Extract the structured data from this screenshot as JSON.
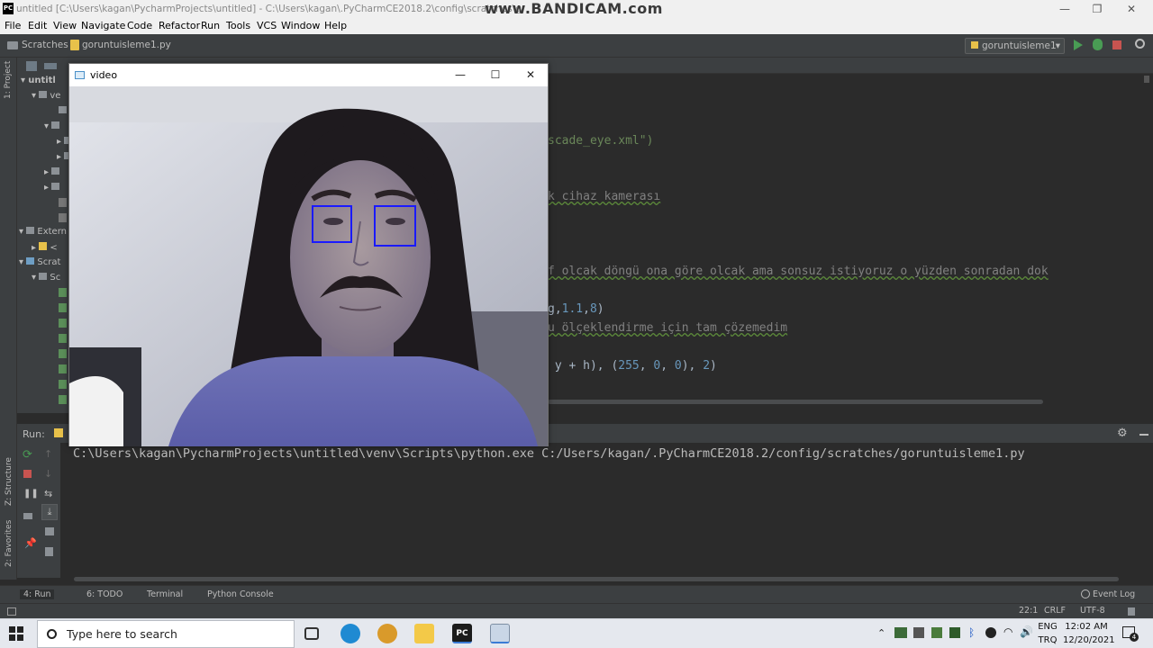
{
  "window": {
    "title": "untitled [C:\\Users\\kagan\\PycharmProjects\\untitled] - C:\\Users\\kagan\\.PyCharmCE2018.2\\config\\scratches\\goruntuisleme1.py",
    "watermark": "www.BANDICAM.com"
  },
  "menu": [
    "File",
    "Edit",
    "View",
    "Navigate",
    "Code",
    "Refactor",
    "Run",
    "Tools",
    "VCS",
    "Window",
    "Help"
  ],
  "breadcrumb": {
    "folder": "Scratches",
    "file": "goruntuisleme1.py"
  },
  "run_config": "goruntuisleme1",
  "tree": {
    "side_label": "1: Project",
    "rows": [
      "untitl",
      "ve",
      "",
      "",
      "",
      "",
      "",
      "",
      "",
      "Extern",
      "<",
      "Scrat",
      "Sc"
    ]
  },
  "editor": {
    "lines": [
      {
        "parts": [
          {
            "t": "scade_eye.xml\")",
            "c": "str"
          }
        ]
      },
      {
        "parts": [
          {
            "t": "k cihaz kamerası",
            "c": "cmt-u"
          }
        ]
      },
      {
        "parts": [
          {
            "t": "f olcak döngü ona göre olcak ama sonsuz istiyoruz o yüzden sonradan dok",
            "c": "cmt-u"
          }
        ]
      },
      {
        "parts": [
          {
            "t": "g,",
            "c": "plain"
          },
          {
            "t": "1.1",
            "c": "num"
          },
          {
            "t": ",",
            "c": "plain"
          },
          {
            "t": "8",
            "c": "num"
          },
          {
            "t": ")",
            "c": "plain"
          }
        ]
      },
      {
        "parts": [
          {
            "t": "u ölçeklendirme için tam çözemedim",
            "c": "cmt-u"
          }
        ]
      },
      {
        "parts": [
          {
            "t": " y + h), (",
            "c": "plain"
          },
          {
            "t": "255",
            "c": "num"
          },
          {
            "t": ", ",
            "c": "plain"
          },
          {
            "t": "0",
            "c": "num"
          },
          {
            "t": ", ",
            "c": "plain"
          },
          {
            "t": "0",
            "c": "num"
          },
          {
            "t": "), ",
            "c": "plain"
          },
          {
            "t": "2",
            "c": "num"
          },
          {
            "t": ")",
            "c": "plain"
          }
        ]
      }
    ]
  },
  "video_window": {
    "title": "video",
    "minimize": "—",
    "maximize": "☐",
    "close": "✕"
  },
  "run_panel": {
    "label": "Run:",
    "command": "C:\\Users\\kagan\\PycharmProjects\\untitled\\venv\\Scripts\\python.exe C:/Users/kagan/.PyCharmCE2018.2/config/scratches/goruntuisleme1.py"
  },
  "side_labels": {
    "structure": "Z: Structure",
    "favorites": "2: Favorites"
  },
  "tool_tabs": [
    "4: Run",
    "6: TODO",
    "Terminal",
    "Python Console"
  ],
  "event_log": "Event Log",
  "status": {
    "position": "22:1",
    "line_sep": "CRLF",
    "encoding": "UTF-8"
  },
  "taskbar": {
    "search_placeholder": "Type here to search",
    "lang_top": "ENG",
    "lang_bottom": "TRQ",
    "time": "12:02 AM",
    "date": "12/20/2021",
    "notif_count": "4"
  },
  "colors": {
    "editor_bg": "#2b2b2b",
    "panel_bg": "#3c3f41",
    "eye_box": "#1a1aff",
    "run_green": "#499c54",
    "stop_red": "#c75450"
  },
  "icons": [
    "pycharm-logo-icon",
    "folder-icon",
    "python-file-icon",
    "run-icon",
    "debug-icon",
    "stop-icon",
    "search-icon",
    "gear-icon",
    "windows-start-icon",
    "task-view-icon",
    "edge-icon",
    "file-explorer-icon",
    "pycharm-taskbar-icon",
    "video-app-icon",
    "wifi-icon",
    "volume-icon",
    "notification-icon"
  ]
}
